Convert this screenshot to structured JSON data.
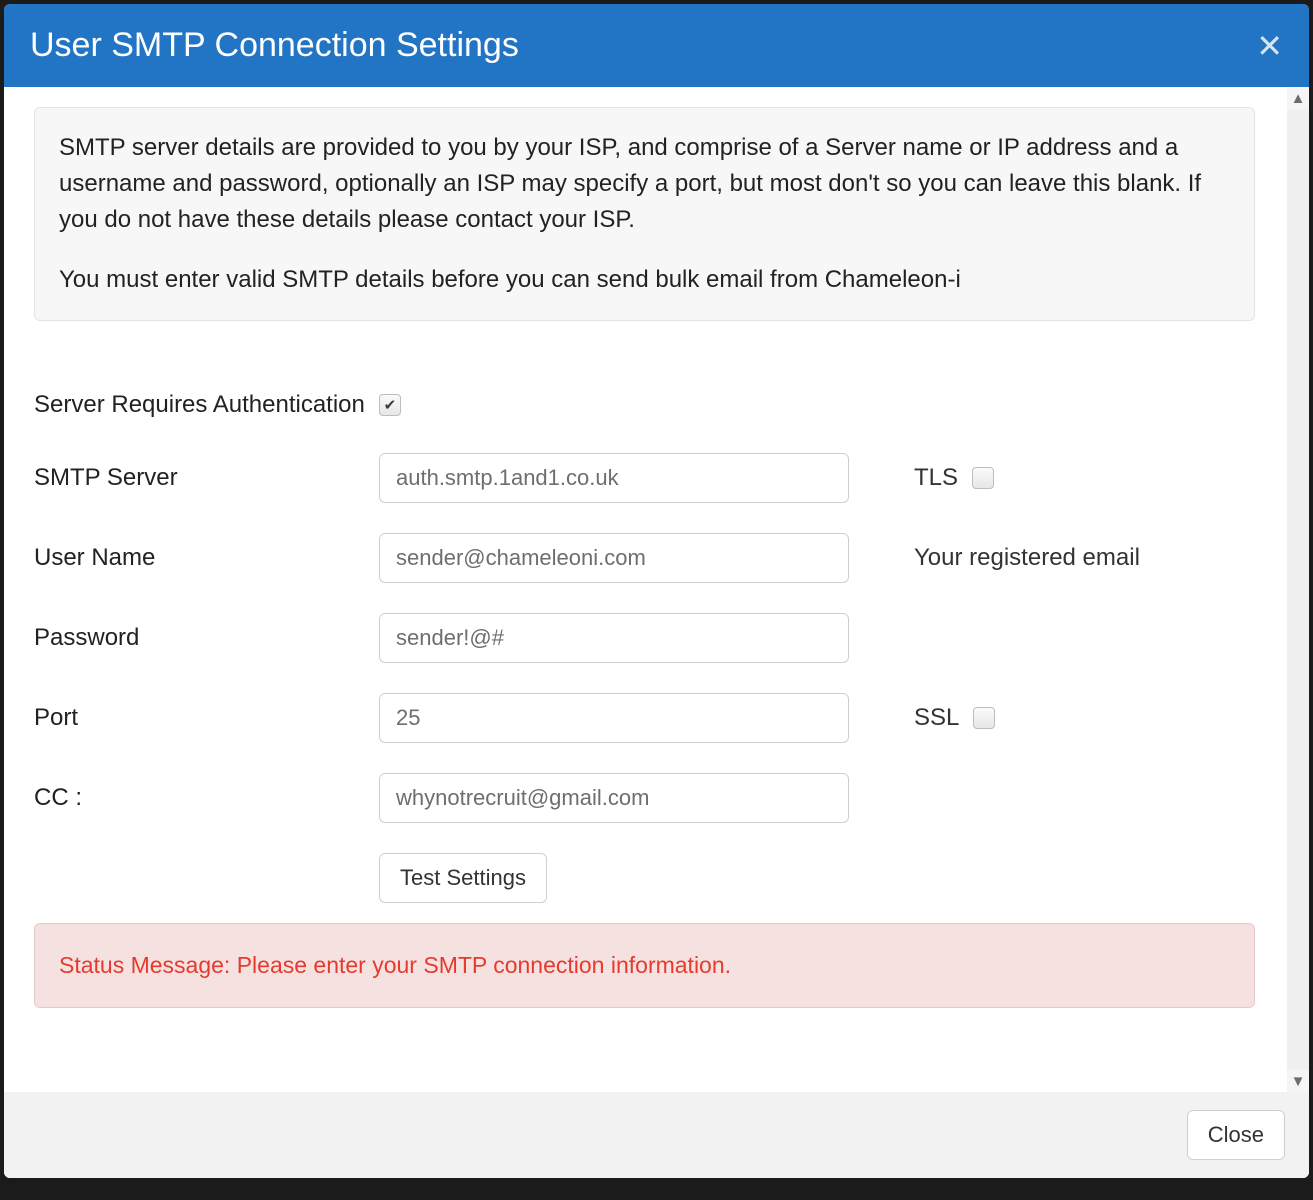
{
  "header": {
    "title": "User SMTP Connection Settings"
  },
  "info": {
    "p1": "SMTP server details are provided to you by your ISP, and comprise of a Server name or IP address and a username and password, optionally an ISP may specify a port, but most don't so you can leave this blank. If you do not have these details please contact your ISP.",
    "p2": "You must enter valid SMTP details before you can send bulk email from Chameleon-i"
  },
  "form": {
    "auth_label": "Server Requires Authentication",
    "auth_checked": true,
    "server_label": "SMTP Server",
    "server_value": "auth.smtp.1and1.co.uk",
    "tls_label": "TLS",
    "tls_checked": false,
    "username_label": "User Name",
    "username_value": "sender@chameleoni.com",
    "registered_email_label": "Your registered email",
    "password_label": "Password",
    "password_value": "sender!@#",
    "port_label": "Port",
    "port_value": "25",
    "ssl_label": "SSL",
    "ssl_checked": false,
    "cc_label": "CC :",
    "cc_value": "whynotrecruit@gmail.com",
    "test_button": "Test Settings"
  },
  "status": {
    "message": "Status Message: Please enter your SMTP connection information."
  },
  "footer": {
    "close_label": "Close"
  }
}
